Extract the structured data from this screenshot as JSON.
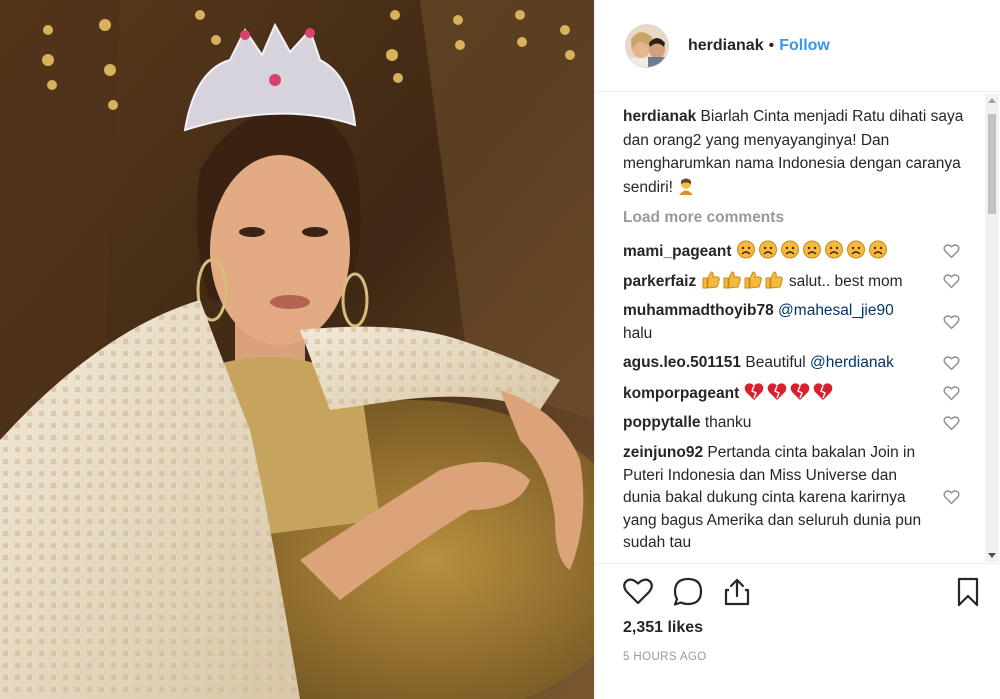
{
  "post": {
    "username": "herdianak",
    "separator": "•",
    "follow_label": "Follow",
    "caption_username": "herdianak",
    "caption_text": "Biarlah Cinta menjadi Ratu dihati saya dan orang2 yang menyayanginya! Dan mengharumkan nama Indonesia dengan caranya sendiri!",
    "load_more_label": "Load more comments",
    "likes": "2,351 likes",
    "time_ago": "5 HOURS AGO"
  },
  "comments": [
    {
      "username": "mami_pageant",
      "text": "",
      "emoji": "disappointed-face x7"
    },
    {
      "username": "parkerfaiz",
      "text": "salut.. best mom",
      "emoji": "thumbs-up x4"
    },
    {
      "username": "muhammadthoyib78",
      "mention": "@mahesal_jie90",
      "text": "halu"
    },
    {
      "username": "agus.leo.501151",
      "text": "Beautiful",
      "mention": "@herdianak"
    },
    {
      "username": "komporpageant",
      "text": "",
      "emoji": "broken-heart x4"
    },
    {
      "username": "poppytalle",
      "text": "thanku"
    },
    {
      "username": "zeinjuno92",
      "text": "Pertanda cinta bakalan Join in Puteri Indonesia dan Miss Universe dan dunia bakal dukung cinta karena karirnya yang bagus Amerika dan seluruh dunia pun sudah tau"
    }
  ],
  "icons": {
    "like": "heart-outline-icon",
    "comment": "speech-bubble-icon",
    "share": "share-icon",
    "save": "bookmark-icon",
    "comment_like": "small-heart-icon"
  },
  "colors": {
    "link_blue": "#3897f0",
    "mention_blue": "#003569",
    "muted_gray": "#999999",
    "text_dark": "#262626"
  }
}
